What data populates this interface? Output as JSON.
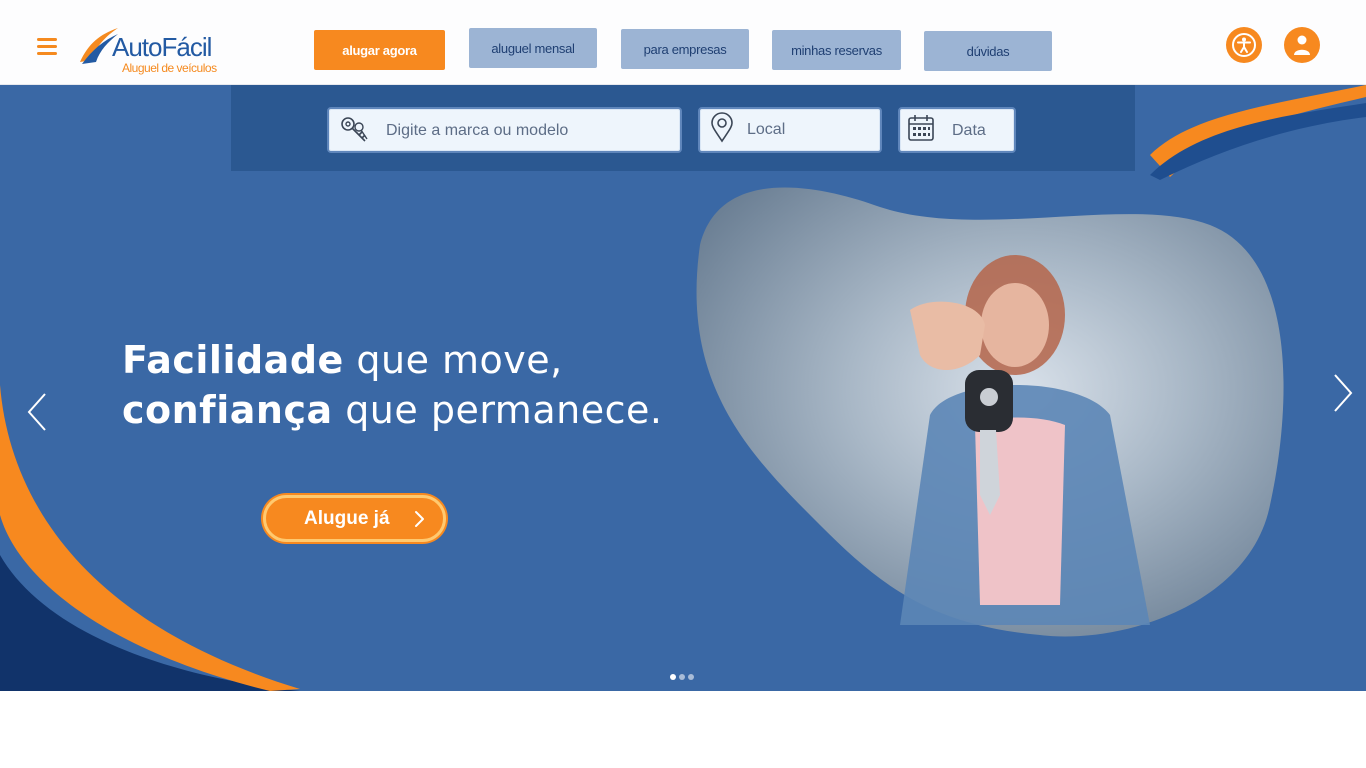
{
  "brand": {
    "name": "AutoFácil",
    "tagline": "Aluguel de veículos"
  },
  "nav": {
    "rent_now": "alugar agora",
    "monthly": "aluguel mensal",
    "business": "para empresas",
    "reservations": "minhas reservas",
    "faq": "dúvidas"
  },
  "icons": {
    "menu": "hamburger-menu-icon",
    "accessibility": "accessibility-icon",
    "user": "user-icon",
    "keys": "car-keys-icon",
    "location": "map-pin-icon",
    "calendar": "calendar-icon"
  },
  "search": {
    "model_placeholder": "Digite a marca ou modelo",
    "location_placeholder": "Local",
    "date_placeholder": "Data"
  },
  "hero": {
    "line1_bold": "Facilidade",
    "line1_rest": " que move,",
    "line2_bold": "confiança",
    "line2_rest": " que permanece.",
    "cta_label": "Alugue já"
  },
  "carousel": {
    "slide_count": 3,
    "active_slide": 1
  },
  "colors": {
    "accent_orange": "#f7891f",
    "brand_blue": "#235aa3",
    "hero_blue": "#3a68a5",
    "panel_blue": "#2b5891",
    "nav_secondary": "#9cb4d4"
  }
}
